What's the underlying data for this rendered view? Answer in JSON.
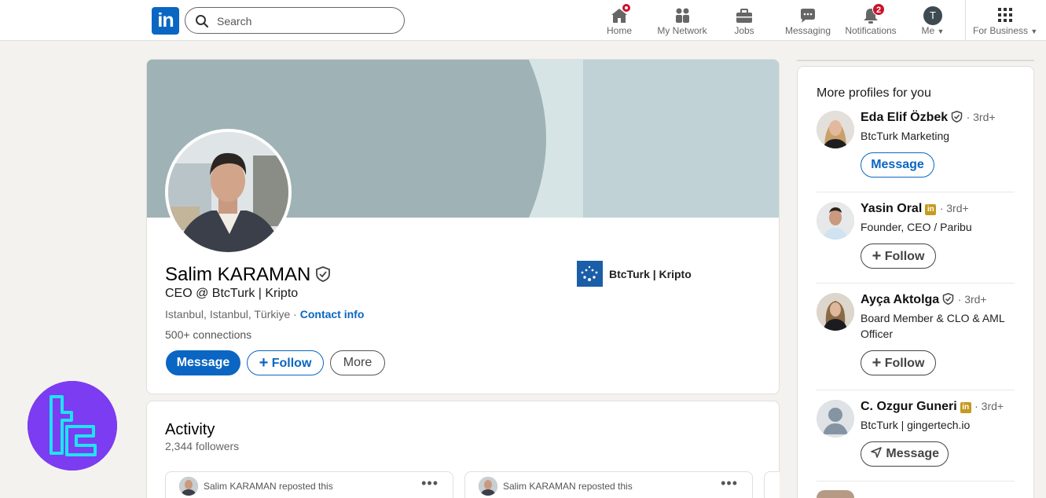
{
  "nav": {
    "logo": "in",
    "search_placeholder": "Search",
    "items": [
      {
        "label": "Home",
        "icon": "home-icon"
      },
      {
        "label": "My Network",
        "icon": "network-icon"
      },
      {
        "label": "Jobs",
        "icon": "briefcase-icon"
      },
      {
        "label": "Messaging",
        "icon": "chat-icon"
      },
      {
        "label": "Notifications",
        "icon": "bell-icon",
        "badge": "2"
      },
      {
        "label": "Me",
        "icon": "avatar-icon",
        "avatar_initial": "T"
      },
      {
        "label": "For Business",
        "icon": "grid-icon"
      }
    ]
  },
  "profile": {
    "name": "Salim KARAMAN",
    "headline": "CEO @ BtcTurk | Kripto",
    "location": "Istanbul, Istanbul, Türkiye",
    "location_sep": " · ",
    "contact_info": "Contact info",
    "connections": "500+ connections",
    "company": "BtcTurk | Kripto",
    "buttons": {
      "message": "Message",
      "follow": "Follow",
      "more": "More"
    }
  },
  "activity": {
    "title": "Activity",
    "followers": "2,344 followers",
    "posts": [
      {
        "text": "Salim KARAMAN reposted this"
      },
      {
        "text": "Salim KARAMAN reposted this"
      }
    ]
  },
  "sidebar": {
    "title": "More profiles for you",
    "people": [
      {
        "name": "Eda Elif Özbek",
        "degree": "· 3rd+",
        "title": "BtcTurk Marketing",
        "button": "Message"
      },
      {
        "name": "Yasin Oral",
        "degree": "· 3rd+",
        "title": "Founder, CEO / Paribu",
        "button": "Follow"
      },
      {
        "name": "Ayça Aktolga",
        "degree": "· 3rd+",
        "title": "Board Member & CLO & AML Officer",
        "button": "Follow"
      },
      {
        "name": "C. Ozgur Guneri",
        "degree": "· 3rd+",
        "title": "BtcTurk | gingertech.io",
        "button": "Message"
      }
    ]
  },
  "colors": {
    "accent": "#0a66c2",
    "background": "#f4f2ee",
    "badge": "#cb112d",
    "watermark": "#7c3cf1"
  }
}
